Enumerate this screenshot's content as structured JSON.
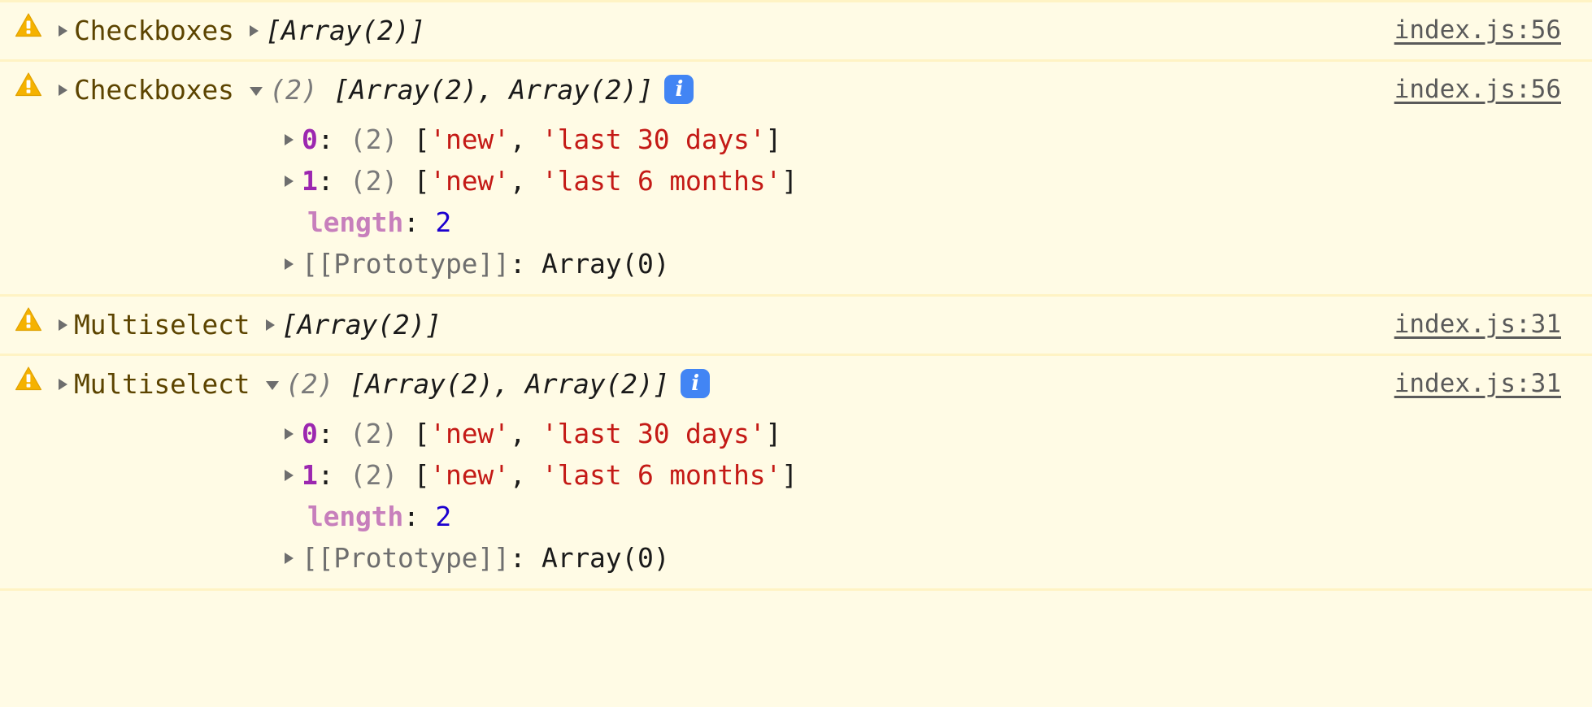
{
  "theme": {
    "background": "#FFFBE5",
    "separator": "#FFF3C4",
    "warning_icon": "#F5B200",
    "message_text": "#5C4400",
    "string_value": "#C41A16",
    "index_key": "#9C27B0",
    "property_name": "#C77FBC",
    "number_value": "#1C00CF",
    "internal_prop": "#6E6E6E",
    "info_badge": "#4285F4",
    "source_link": "#5A5A5A"
  },
  "icons": {
    "warning": "warning-triangle-icon",
    "info": "info-badge-icon",
    "expand_collapsed": "chevron-right-icon",
    "expand_expanded": "chevron-down-icon"
  },
  "messages": [
    {
      "level": "warning",
      "label": "Checkboxes",
      "preview": "[Array(2)]",
      "expanded": false,
      "source": "index.js:56",
      "info_badge": null,
      "details": []
    },
    {
      "level": "warning",
      "label": "Checkboxes",
      "expanded": true,
      "count": "(2)",
      "preview": "[Array(2), Array(2)]",
      "info_badge": "i",
      "source": "index.js:56",
      "details": [
        {
          "kind": "index",
          "chevron": true,
          "key": "0",
          "colon": ":",
          "count": "(2)",
          "open": "[",
          "items": [
            "'new'",
            "'last 30 days'"
          ],
          "sep": ", ",
          "close": "]"
        },
        {
          "kind": "index",
          "chevron": true,
          "key": "1",
          "colon": ":",
          "count": "(2)",
          "open": "[",
          "items": [
            "'new'",
            "'last 6 months'"
          ],
          "sep": ", ",
          "close": "]"
        },
        {
          "kind": "prop",
          "chevron": false,
          "key": "length",
          "colon": ":",
          "value": "2"
        },
        {
          "kind": "internal",
          "chevron": true,
          "key": "[[Prototype]]",
          "colon": ":",
          "value": "Array(0)"
        }
      ]
    },
    {
      "level": "warning",
      "label": "Multiselect",
      "preview": "[Array(2)]",
      "expanded": false,
      "source": "index.js:31",
      "info_badge": null,
      "details": []
    },
    {
      "level": "warning",
      "label": "Multiselect",
      "expanded": true,
      "count": "(2)",
      "preview": "[Array(2), Array(2)]",
      "info_badge": "i",
      "source": "index.js:31",
      "details": [
        {
          "kind": "index",
          "chevron": true,
          "key": "0",
          "colon": ":",
          "count": "(2)",
          "open": "[",
          "items": [
            "'new'",
            "'last 30 days'"
          ],
          "sep": ", ",
          "close": "]"
        },
        {
          "kind": "index",
          "chevron": true,
          "key": "1",
          "colon": ":",
          "count": "(2)",
          "open": "[",
          "items": [
            "'new'",
            "'last 6 months'"
          ],
          "sep": ", ",
          "close": "]"
        },
        {
          "kind": "prop",
          "chevron": false,
          "key": "length",
          "colon": ":",
          "value": "2"
        },
        {
          "kind": "internal",
          "chevron": true,
          "key": "[[Prototype]]",
          "colon": ":",
          "value": "Array(0)"
        }
      ]
    }
  ]
}
